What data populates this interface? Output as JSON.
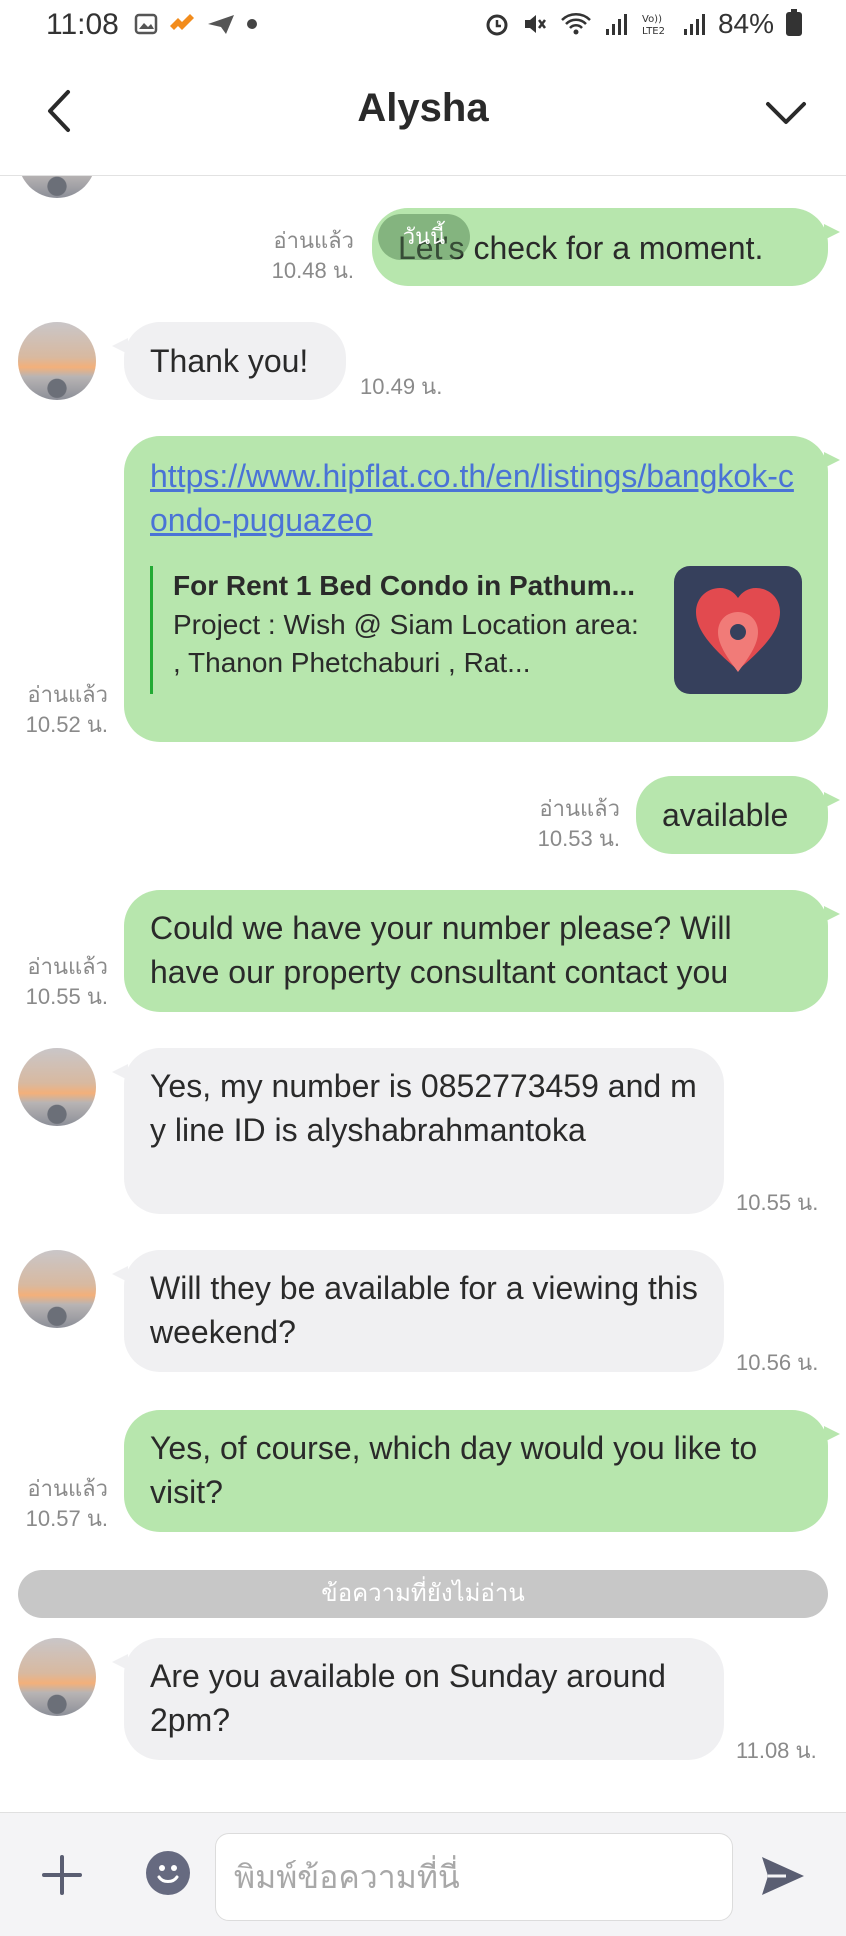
{
  "status_bar": {
    "time": "11:08",
    "battery": "84%"
  },
  "header": {
    "title": "Alysha"
  },
  "date_separator": "วันนี้",
  "messages": [
    {
      "side": "out",
      "text": "Let's check for a moment.",
      "read_label": "อ่านแล้ว",
      "time": "10.48 น."
    },
    {
      "side": "in",
      "text": "Thank you!",
      "time": "10.49 น."
    },
    {
      "side": "out",
      "link": "https://www.hipflat.co.th/en/listings/bangkok-condo-puguazeo",
      "preview_title": "For Rent 1 Bed Condo in Pathum...",
      "preview_desc": "Project : Wish @ Siam Location area: , Thanon Phetchaburi , Rat...",
      "read_label": "อ่านแล้ว",
      "time": "10.52 น."
    },
    {
      "side": "out",
      "text": "available",
      "read_label": "อ่านแล้ว",
      "time": "10.53 น."
    },
    {
      "side": "out",
      "text": "Could we have your number please? Will have our property consultant contact you",
      "read_label": "อ่านแล้ว",
      "time": "10.55 น."
    },
    {
      "side": "in",
      "text": "Yes, my number is 0852773459 and my line ID is alyshabrahmantoka",
      "time": "10.55 น."
    },
    {
      "side": "in",
      "text": "Will they be available for a viewing this weekend?",
      "time": "10.56 น."
    },
    {
      "side": "out",
      "text": "Yes, of course, which day would you like to visit?",
      "read_label": "อ่านแล้ว",
      "time": "10.57 น."
    },
    {
      "side": "in",
      "text": "Are you available on Sunday around 2pm?",
      "time": "11.08 น."
    }
  ],
  "unread_divider": "ข้อความที่ยังไม่อ่าน",
  "input": {
    "placeholder": "พิมพ์ข้อความที่นี่"
  },
  "colors": {
    "outgoing_bubble": "#b7e6ad",
    "incoming_bubble": "#f0f0f2",
    "link": "#4a73d6",
    "preview_bar": "#22aa33"
  }
}
